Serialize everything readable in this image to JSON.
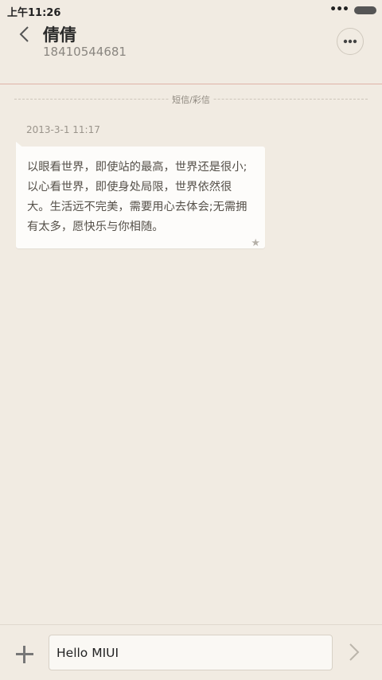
{
  "status_bar": {
    "time": "上午11:26",
    "signal_dots": "•••"
  },
  "header": {
    "contact_name": "倩倩",
    "phone_number": "18410544681"
  },
  "section_label": "短信/彩信",
  "message": {
    "timestamp": "2013-3-1 11:17",
    "text": "以眼看世界，即使站的最高，世界还是很小;以心看世界，即使身处局限，世界依然很大。生活远不完美，需要用心去体会;无需拥有太多，愿快乐与你相随。",
    "star": "★"
  },
  "composer": {
    "input_value": "Hello MIUI"
  },
  "icons": {
    "back": "back-chevron-icon",
    "more": "more-options-icon",
    "add": "plus-icon",
    "send": "send-chevron-icon",
    "star": "star-icon",
    "battery": "battery-icon"
  }
}
